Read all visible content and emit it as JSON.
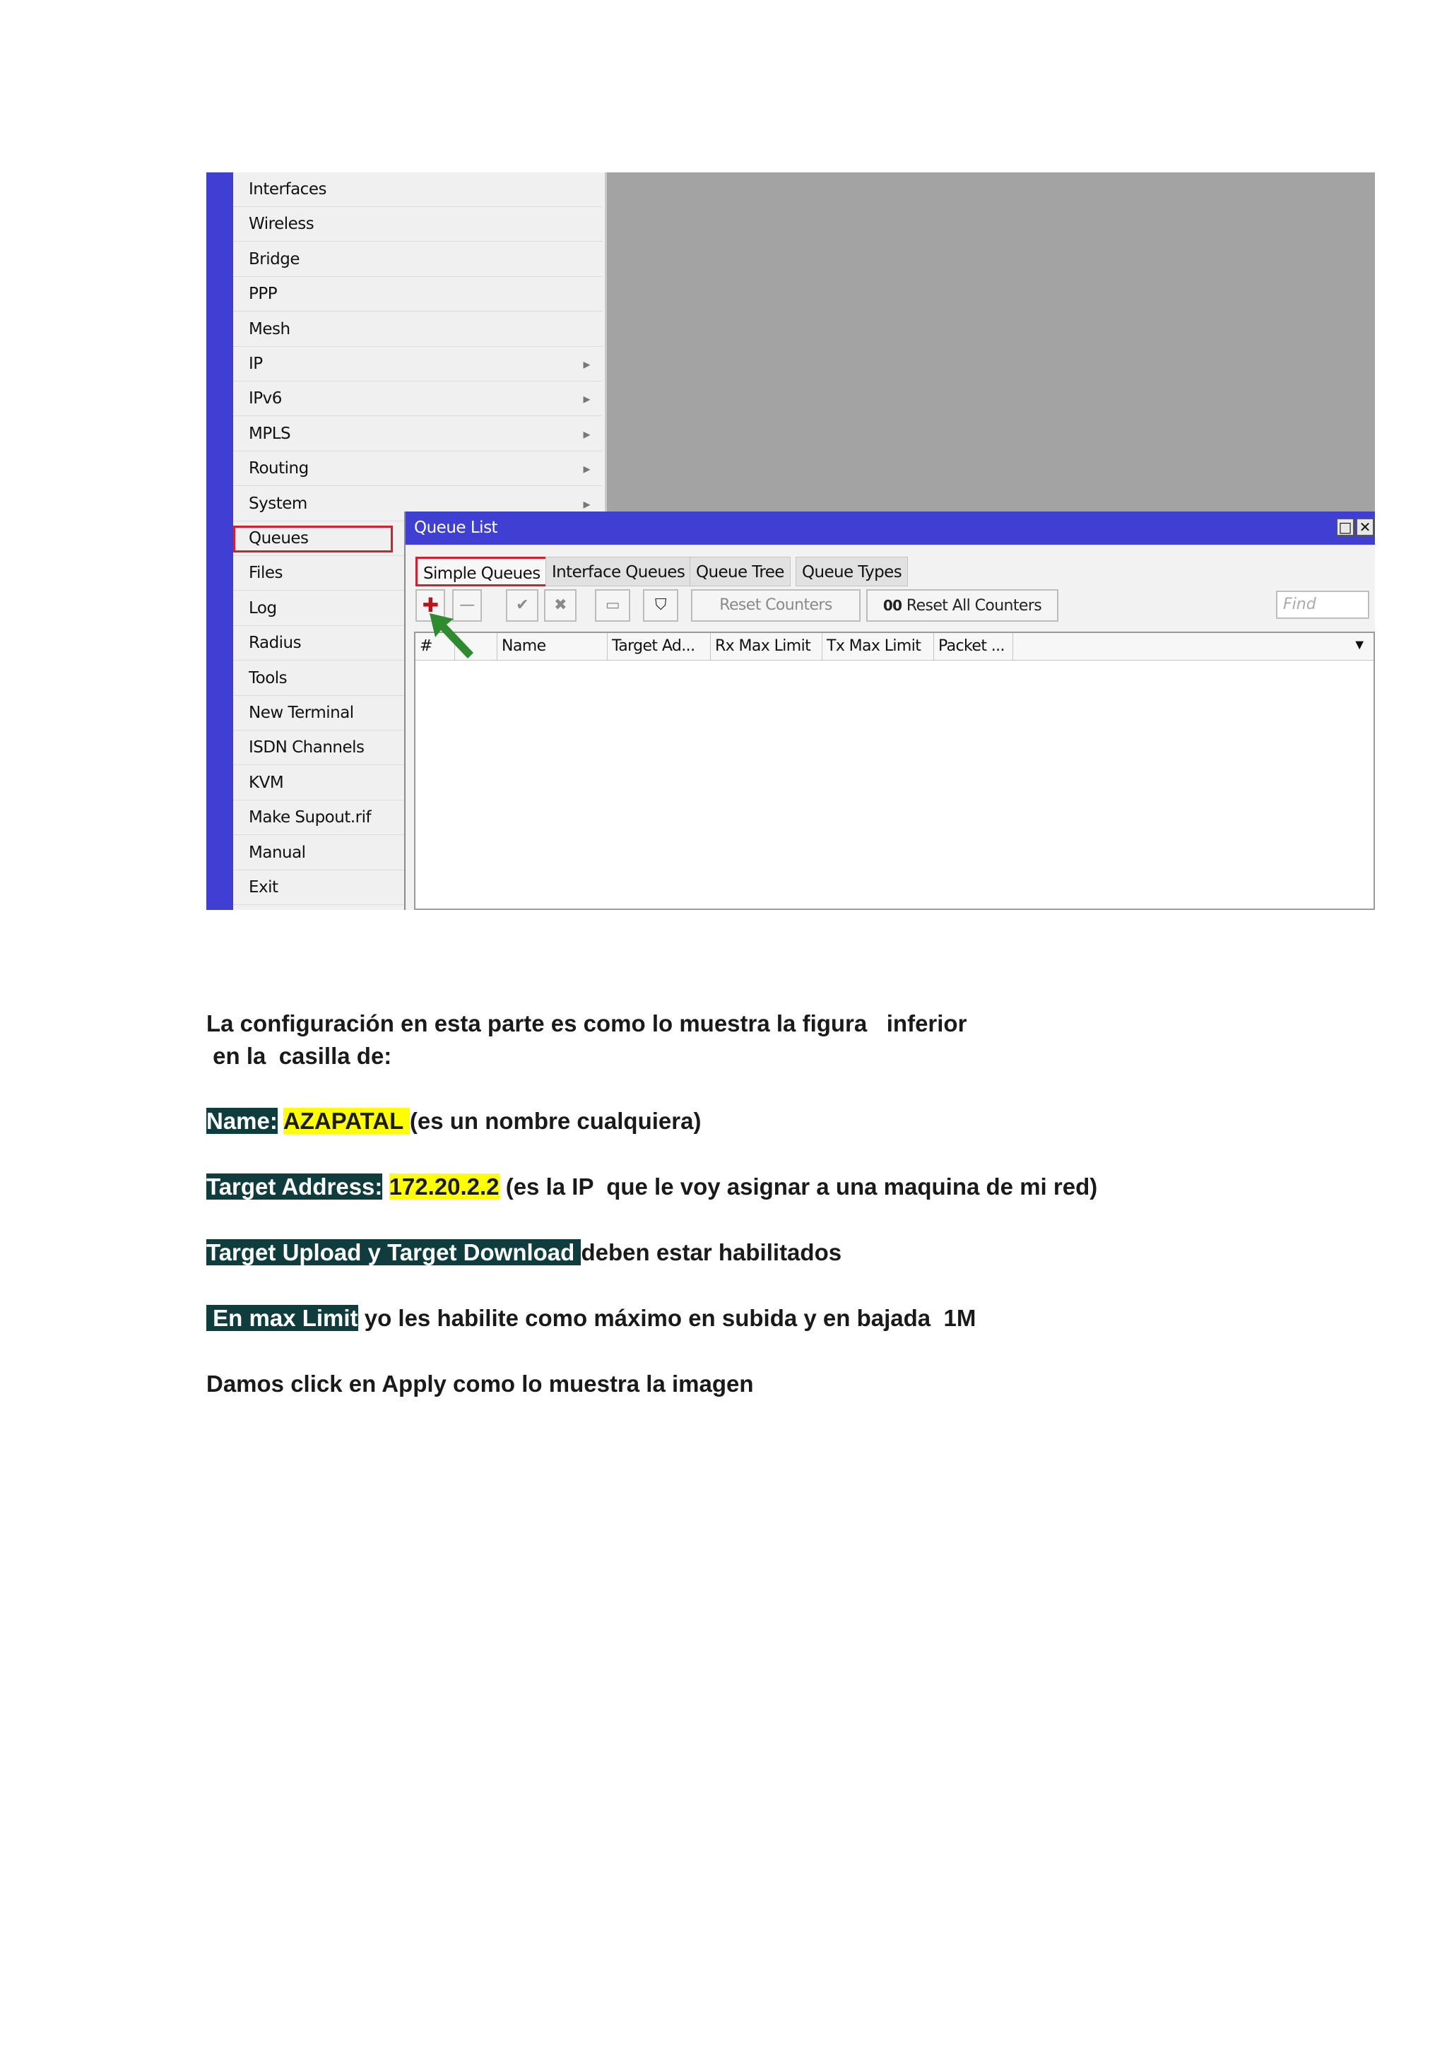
{
  "sidebar": {
    "items": [
      {
        "label": "Interfaces",
        "submenu": false
      },
      {
        "label": "Wireless",
        "submenu": false
      },
      {
        "label": "Bridge",
        "submenu": false
      },
      {
        "label": "PPP",
        "submenu": false
      },
      {
        "label": "Mesh",
        "submenu": false
      },
      {
        "label": "IP",
        "submenu": true
      },
      {
        "label": "IPv6",
        "submenu": true
      },
      {
        "label": "MPLS",
        "submenu": true
      },
      {
        "label": "Routing",
        "submenu": true
      },
      {
        "label": "System",
        "submenu": true
      },
      {
        "label": "Queues",
        "submenu": false
      },
      {
        "label": "Files",
        "submenu": false
      },
      {
        "label": "Log",
        "submenu": false
      },
      {
        "label": "Radius",
        "submenu": false
      },
      {
        "label": "Tools",
        "submenu": true
      },
      {
        "label": "New Terminal",
        "submenu": false
      },
      {
        "label": "ISDN Channels",
        "submenu": false
      },
      {
        "label": "KVM",
        "submenu": false
      },
      {
        "label": "Make Supout.rif",
        "submenu": false
      },
      {
        "label": "Manual",
        "submenu": false
      },
      {
        "label": "Exit",
        "submenu": false
      }
    ],
    "submenu_glyph": "▸"
  },
  "window": {
    "title": "Queue List",
    "restore_glyph": "□",
    "close_glyph": "✕",
    "tabs": [
      "Simple Queues",
      "Interface Queues",
      "Queue Tree",
      "Queue Types"
    ],
    "toolbar": {
      "add": "✚",
      "remove": "—",
      "enable": "✔",
      "disable": "✖",
      "comment": "▭",
      "filter": "⛉",
      "reset_counters": "Reset Counters",
      "reset_all_counters": "Reset All Counters",
      "reset_all_prefix": "00",
      "find_placeholder": "Find"
    },
    "columns": [
      "#",
      "",
      "Name",
      "Target Ad...",
      "Rx Max Limit",
      "Tx Max Limit",
      "Packet ..."
    ],
    "column_dropdown": "▼"
  },
  "text": {
    "intro_line1": "La configuración en esta parte es como lo muestra la figura   inferior",
    "intro_line2": " en la  casilla de:",
    "name_label": "Name:",
    "name_value": "AZAPATAL ",
    "name_note": "(es un nombre cualquiera)",
    "target_label": "Target Address:",
    "target_value": "172.20.2.2",
    "target_note": " (es la IP  que le voy asignar a una maquina de mi red)",
    "upload_label": "Target Upload y Target Download ",
    "upload_note": "deben estar habilitados",
    "maxlimit_label": " En max Limit",
    "maxlimit_note": " yo les habilite como máximo en subida y en bajada  1M",
    "apply_line": "Damos click en Apply como lo muestra la imagen"
  },
  "colors": {
    "winbox_blue": "#3f3fd4",
    "highlight_red": "#d2212a",
    "arrow_green": "#2e8b2e",
    "dark_highlight": "#0f3d3d",
    "yellow_highlight": "#ffff00"
  }
}
